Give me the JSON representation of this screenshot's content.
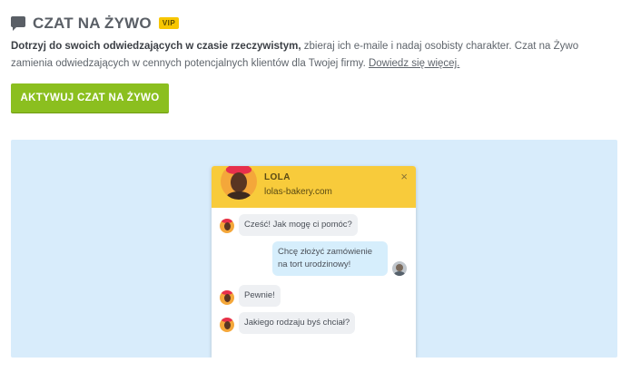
{
  "header": {
    "title": "CZAT NA ŻYWO",
    "badge": "VIP",
    "icon": "chat-icon"
  },
  "description": {
    "bold": "Dotrzyj do swoich odwiedzających w czasie rzeczywistym,",
    "text": " zbieraj ich e-maile i nadaj osobisty charakter. Czat na Żywo zamienia odwiedzających w cennych potencjalnych klientów dla Twojej firmy. ",
    "link": "Dowiedz się więcej."
  },
  "actions": {
    "activate_label": "AKTYWUJ CZAT NA ŻYWO"
  },
  "chat_preview": {
    "agent_name": "LOLA",
    "agent_site": "lolas-bakery.com",
    "close_symbol": "×",
    "messages": [
      {
        "from": "agent",
        "text": "Cześć! Jak mogę ci pomóc?"
      },
      {
        "from": "user",
        "text": "Chcę złożyć zamówienie na tort urodzinowy!"
      },
      {
        "from": "agent",
        "text": "Pewnie!"
      },
      {
        "from": "agent",
        "text": "Jakiego rodzaju byś chciał?"
      }
    ]
  },
  "colors": {
    "accent_green": "#8bbf1f",
    "vip_yellow": "#f7c600",
    "chat_header_yellow": "#f8cb3b",
    "preview_background": "#d8ecfb"
  }
}
